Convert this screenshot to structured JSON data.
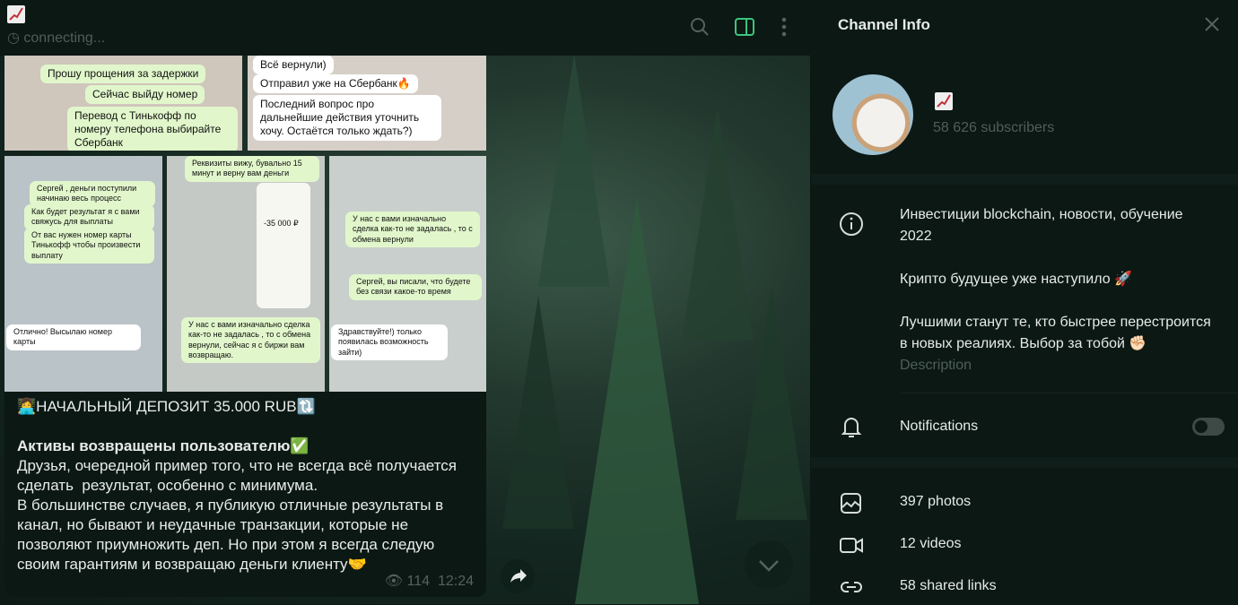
{
  "header": {
    "title_emoji": "📈",
    "status": "connecting..."
  },
  "photos": {
    "top_left": [
      "Прошу прощения за задержки",
      "Сейчас выйду номер",
      "Перевод с Тинькофф по номеру телефона выбирайте Сбербанк"
    ],
    "top_right": [
      "Всё вернули)",
      "Отправил уже на Сбербанк🔥",
      "Последний вопрос про дальнейшие действия уточнить хочу. Остаётся только ждать?)"
    ],
    "bottom_left": [
      "Сергей , деньги поступили начинаю весь процесс",
      "Как будет результат я с вами свяжусь для выплаты",
      "От вас нужен номер карты Тинькофф чтобы произвести выплату",
      "Отлично! Высылаю номер карты"
    ],
    "bottom_mid": [
      "Реквизиты вижу, бувально 15 минут и верну вам деньги",
      "-35 000 ₽",
      "У нас с вами изначально сделка как-то не задалась , то с обмена вернули, сейчас я с биржи вам возвращаю."
    ],
    "bottom_right": [
      "У нас с вами изначально сделка как-то не задалась , то с обмена вернули",
      "Сергей, вы писали, что будете без связи какое-то время",
      "Здравствуйте!) только появилась возможность зайти)"
    ]
  },
  "message": {
    "headline": "👩‍💻НАЧАЛЬНЫЙ ДЕПОЗИТ 35.000 RUB🔃",
    "subhead": "Активы возвращены пользователю✅",
    "body": "Друзья, очередной пример того, что не всегда всё получается сделать  результат, особенно с минимума.\nВ большинстве случаев, я публикую отличные результаты в канал, но бывают и неудачные транзакции, которые не позволяют приумножить деп. Но при этом я всегда следую своим гарантиям и возвращаю деньги клиенту🤝",
    "views": "114",
    "time": "12:24"
  },
  "panel": {
    "title": "Channel Info",
    "channel_emoji": "📈",
    "subscribers": "58 626 subscribers",
    "description": "Инвестиции blockchain, новости, обучение 2022\n\nКрипто будущее уже наступило 🚀\n\nЛучшими станут те, кто быстрее перестроится в новых реалиях. Выбор за тобой ✊🏻",
    "description_label": "Description",
    "notifications_label": "Notifications",
    "notifications_on": false,
    "photos": "397 photos",
    "videos": "12 videos",
    "links": "58 shared links"
  },
  "colors": {
    "accent": "#3ec47d",
    "background": "#0b1814"
  }
}
